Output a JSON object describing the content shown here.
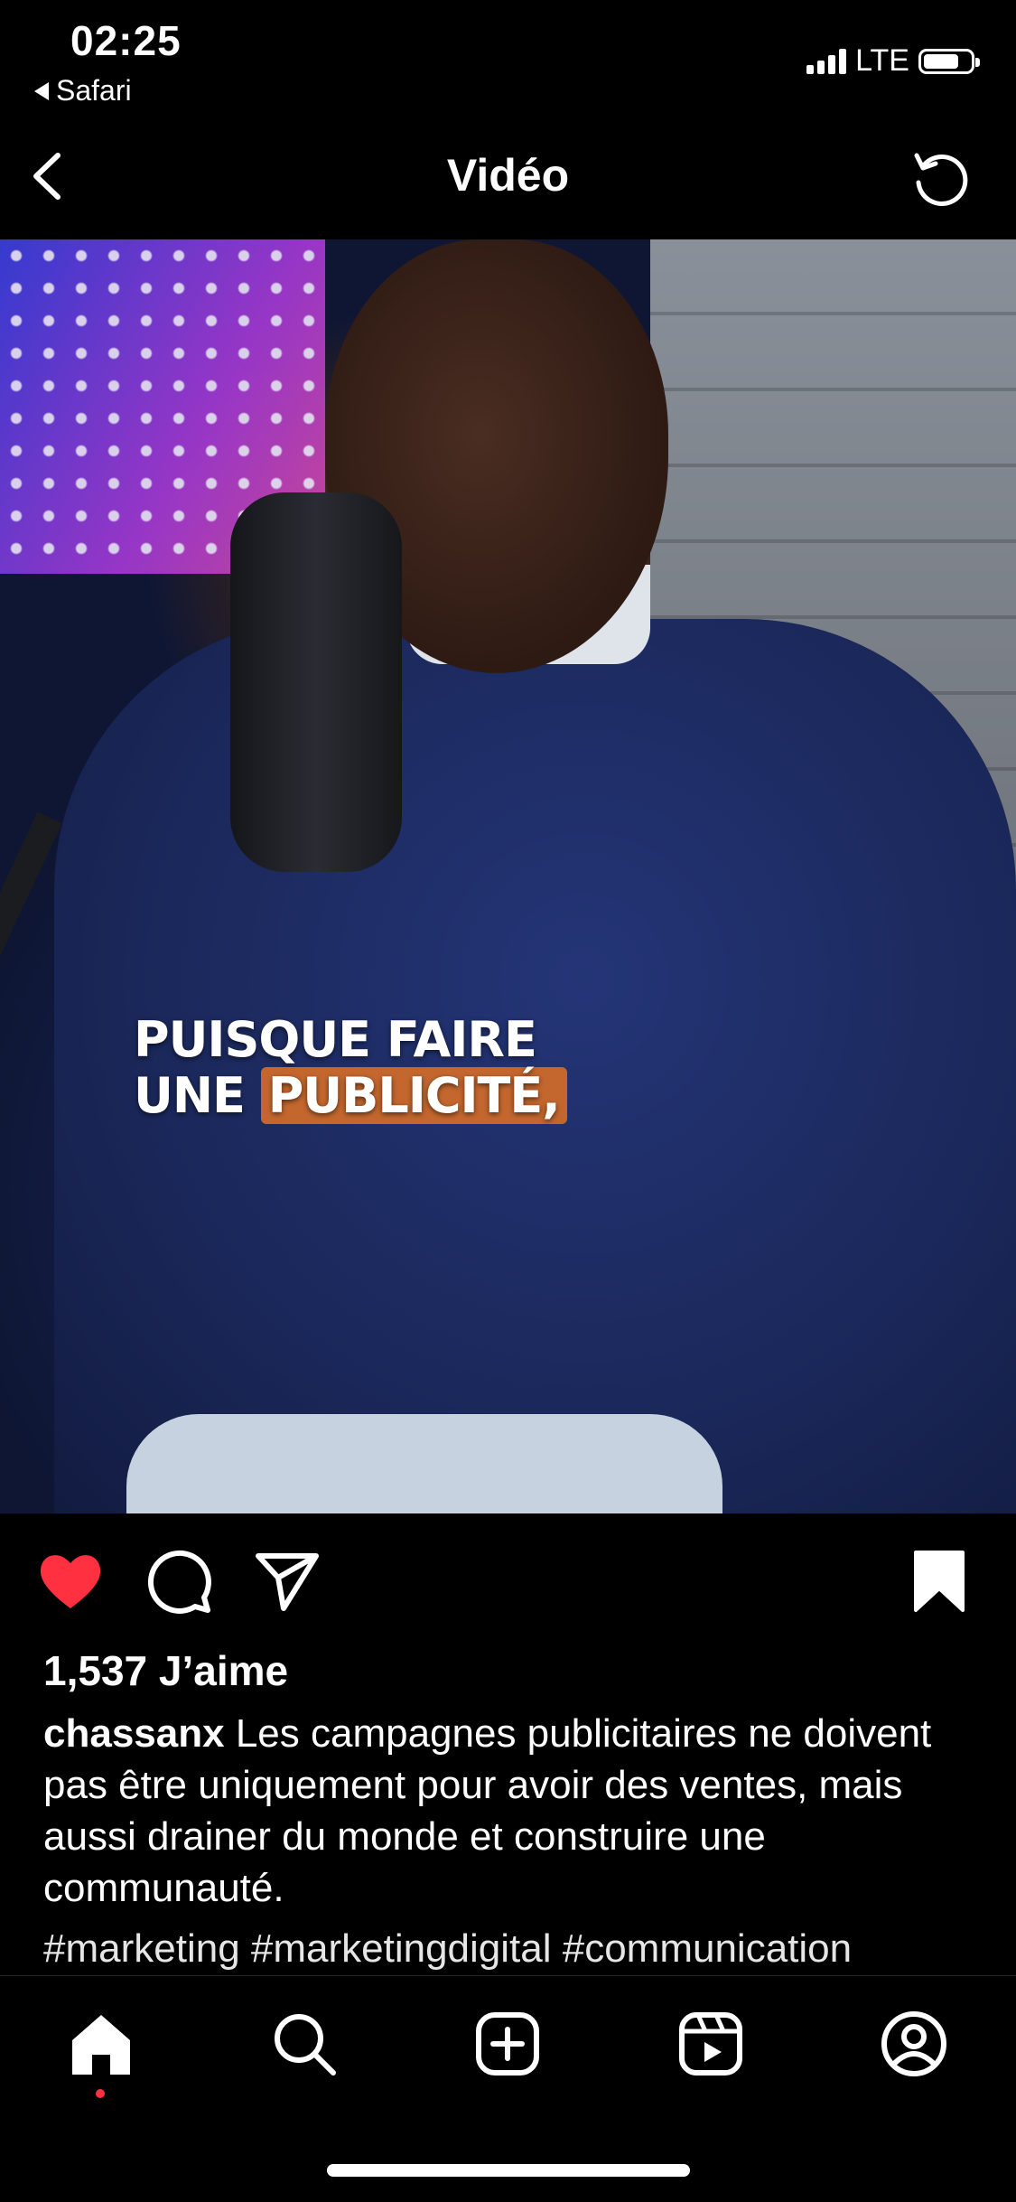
{
  "status_bar": {
    "time": "02:25",
    "back_app": "Safari",
    "network": "LTE",
    "battery_level": 0.75
  },
  "header": {
    "title": "Vidéo",
    "back_icon": "chevron-left-icon",
    "refresh_icon": "refresh-icon"
  },
  "video": {
    "caption_line1": "PUISQUE FAIRE",
    "caption_line2_a": "UNE ",
    "caption_line2_b": "PUBLICITÉ,",
    "caption_highlight_color": "#c4672e",
    "sound_icon": "speaker-icon"
  },
  "actions": {
    "like_icon": "heart-filled-icon",
    "like_color": "#ff3040",
    "comment_icon": "comment-icon",
    "share_icon": "send-icon",
    "save_icon": "bookmark-filled-icon"
  },
  "post": {
    "likes": "1,537 J’aime",
    "username": "chassanx",
    "caption": "Les campagnes publicitaires ne doivent pas être uniquement pour avoir des ventes, mais aussi drainer du monde et construire une communauté.",
    "hashtags": "#marketing #marketingdigital #communication"
  },
  "tabbar": {
    "items": [
      {
        "name": "home",
        "icon": "home-icon",
        "active": true
      },
      {
        "name": "search",
        "icon": "search-icon"
      },
      {
        "name": "create",
        "icon": "plus-square-icon"
      },
      {
        "name": "reels",
        "icon": "reels-icon"
      },
      {
        "name": "profile",
        "icon": "profile-icon"
      }
    ]
  }
}
